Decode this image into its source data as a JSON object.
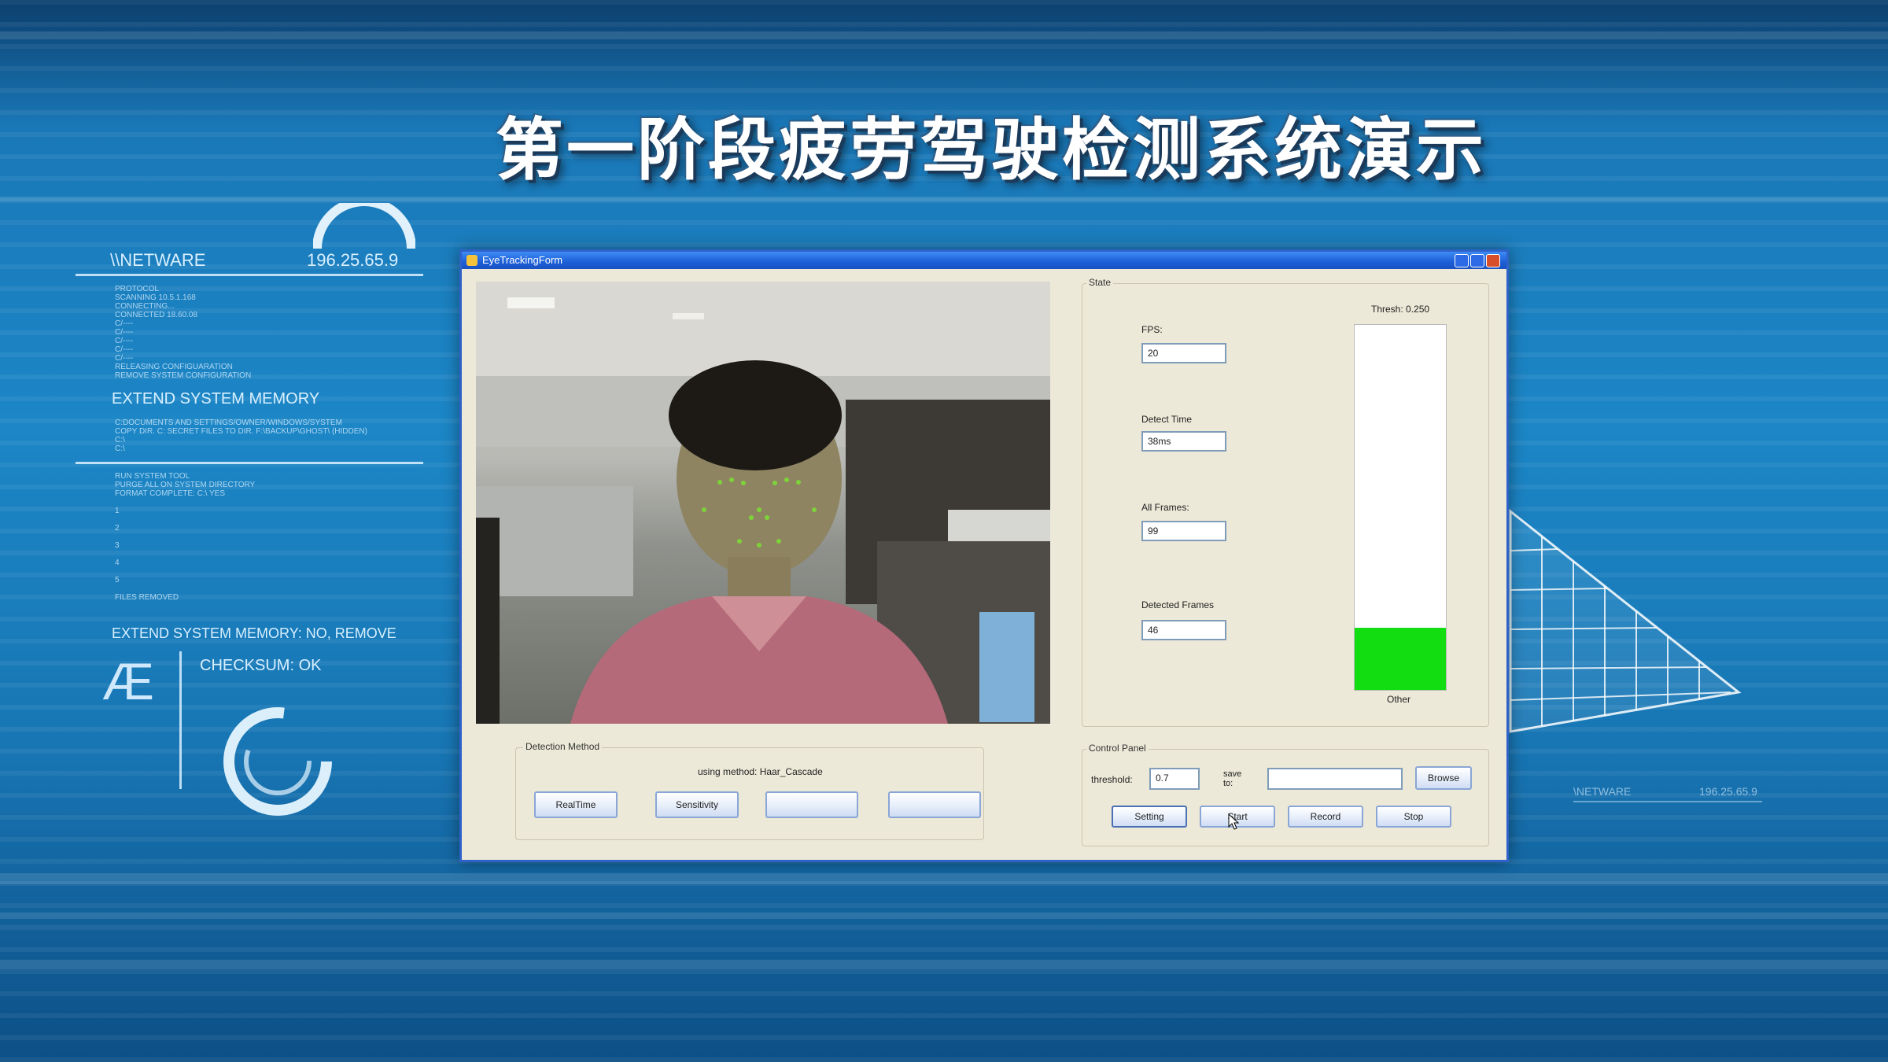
{
  "title": "第一阶段疲劳驾驶检测系统演示",
  "hud": {
    "netware": "\\\\NETWARE",
    "ip": "196.25.65.9",
    "protocol_lines": "PROTOCOL\nSCANNING 10.5.1.168\nCONNECTING...\nCONNECTED 18.60.08\nC/----\nC/----\nC/----\nC/----\nC/----\nRELEASING CONFIGUARATION\nREMOVE SYSTEM CONFIGURATION",
    "extend_memory": "EXTEND SYSTEM MEMORY",
    "docs_lines": "C:DOCUMENTS AND SETTINGS/OWNER/WINDOWS/SYSTEM\nCOPY DIR. C: SECRET FILES TO DIR. F:\\BACKUP\\GHOST\\ (HIDDEN)\nC:\\\nC:\\",
    "run_lines": "RUN SYSTEM TOOL\nPURGE ALL ON SYSTEM DIRECTORY\nFORMAT COMPLETE: C:\\ YES\n\n1\n\n2\n\n3\n\n4\n\n5\n\nFILES REMOVED",
    "extend_memory_no": "EXTEND SYSTEM MEMORY: NO, REMOVE",
    "ae": "Æ",
    "checksum": "CHECKSUM: OK",
    "netware_small": "\\NETWARE",
    "ip_small": "196.25.65.9"
  },
  "window": {
    "title": "EyeTrackingForm",
    "state_group": "State",
    "thresh_label": "Thresh: 0.250",
    "fps_label": "FPS:",
    "fps_value": "20",
    "detect_time_label": "Detect Time",
    "detect_time_value": "38ms",
    "all_frames_label": "All Frames:",
    "all_frames_value": "99",
    "detected_frames_label": "Detected Frames",
    "detected_frames_value": "46",
    "bar_caption": "Other",
    "bar_level": 0.17,
    "detection_group": "Detection Method",
    "using_method": "using method: Haar_Cascade",
    "method_buttons": [
      "RealTime",
      "Sensitivity",
      "",
      ""
    ],
    "control_group": "Control Panel",
    "threshold_label": "threshold:",
    "threshold_value": "0.7",
    "save_to_label": "save\nto:",
    "save_to_value": "",
    "browse_button": "Browse",
    "setting_button": "Setting",
    "start_button": "Start",
    "record_button": "Record",
    "stop_button": "Stop"
  },
  "colors": {
    "bar_fill": "#11dd11",
    "titlebar": "#1c5ed7"
  }
}
